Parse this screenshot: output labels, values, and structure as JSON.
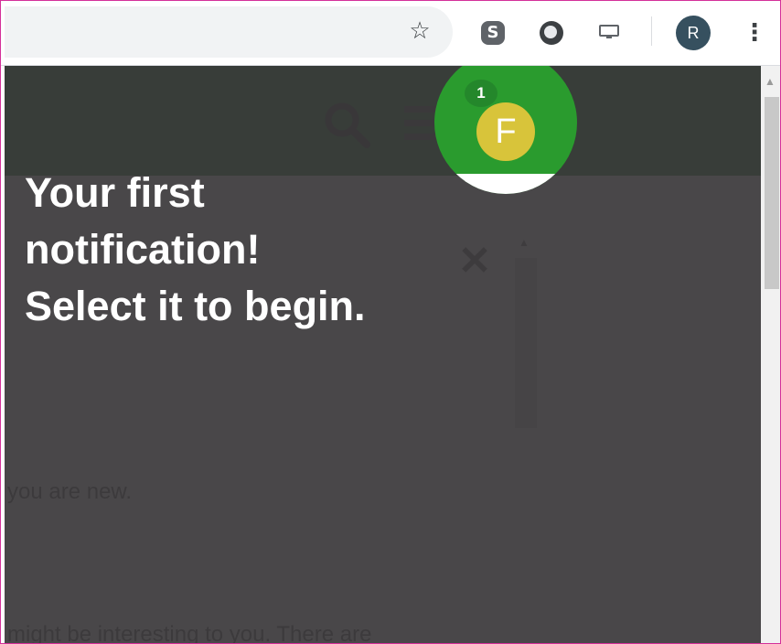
{
  "browser": {
    "profile_initial": "R",
    "icons": [
      "star-icon",
      "skype-icon",
      "extension-icon",
      "cast-icon",
      "menu-icon"
    ]
  },
  "app": {
    "notification_count": "1",
    "user_initial": "F",
    "panel_text_1": "you are new.",
    "panel_text_2": "might be interesting to you. There are",
    "close_symbol": "✕"
  },
  "tour": {
    "line1": "Your first",
    "line2": "notification!",
    "line3": "Select it to begin."
  },
  "colors": {
    "header": "#2d7a38",
    "spotlight": "#2a9b2e",
    "avatar": "#d8c43a",
    "overlay": "#3a373a",
    "frame": "#d4309a"
  }
}
